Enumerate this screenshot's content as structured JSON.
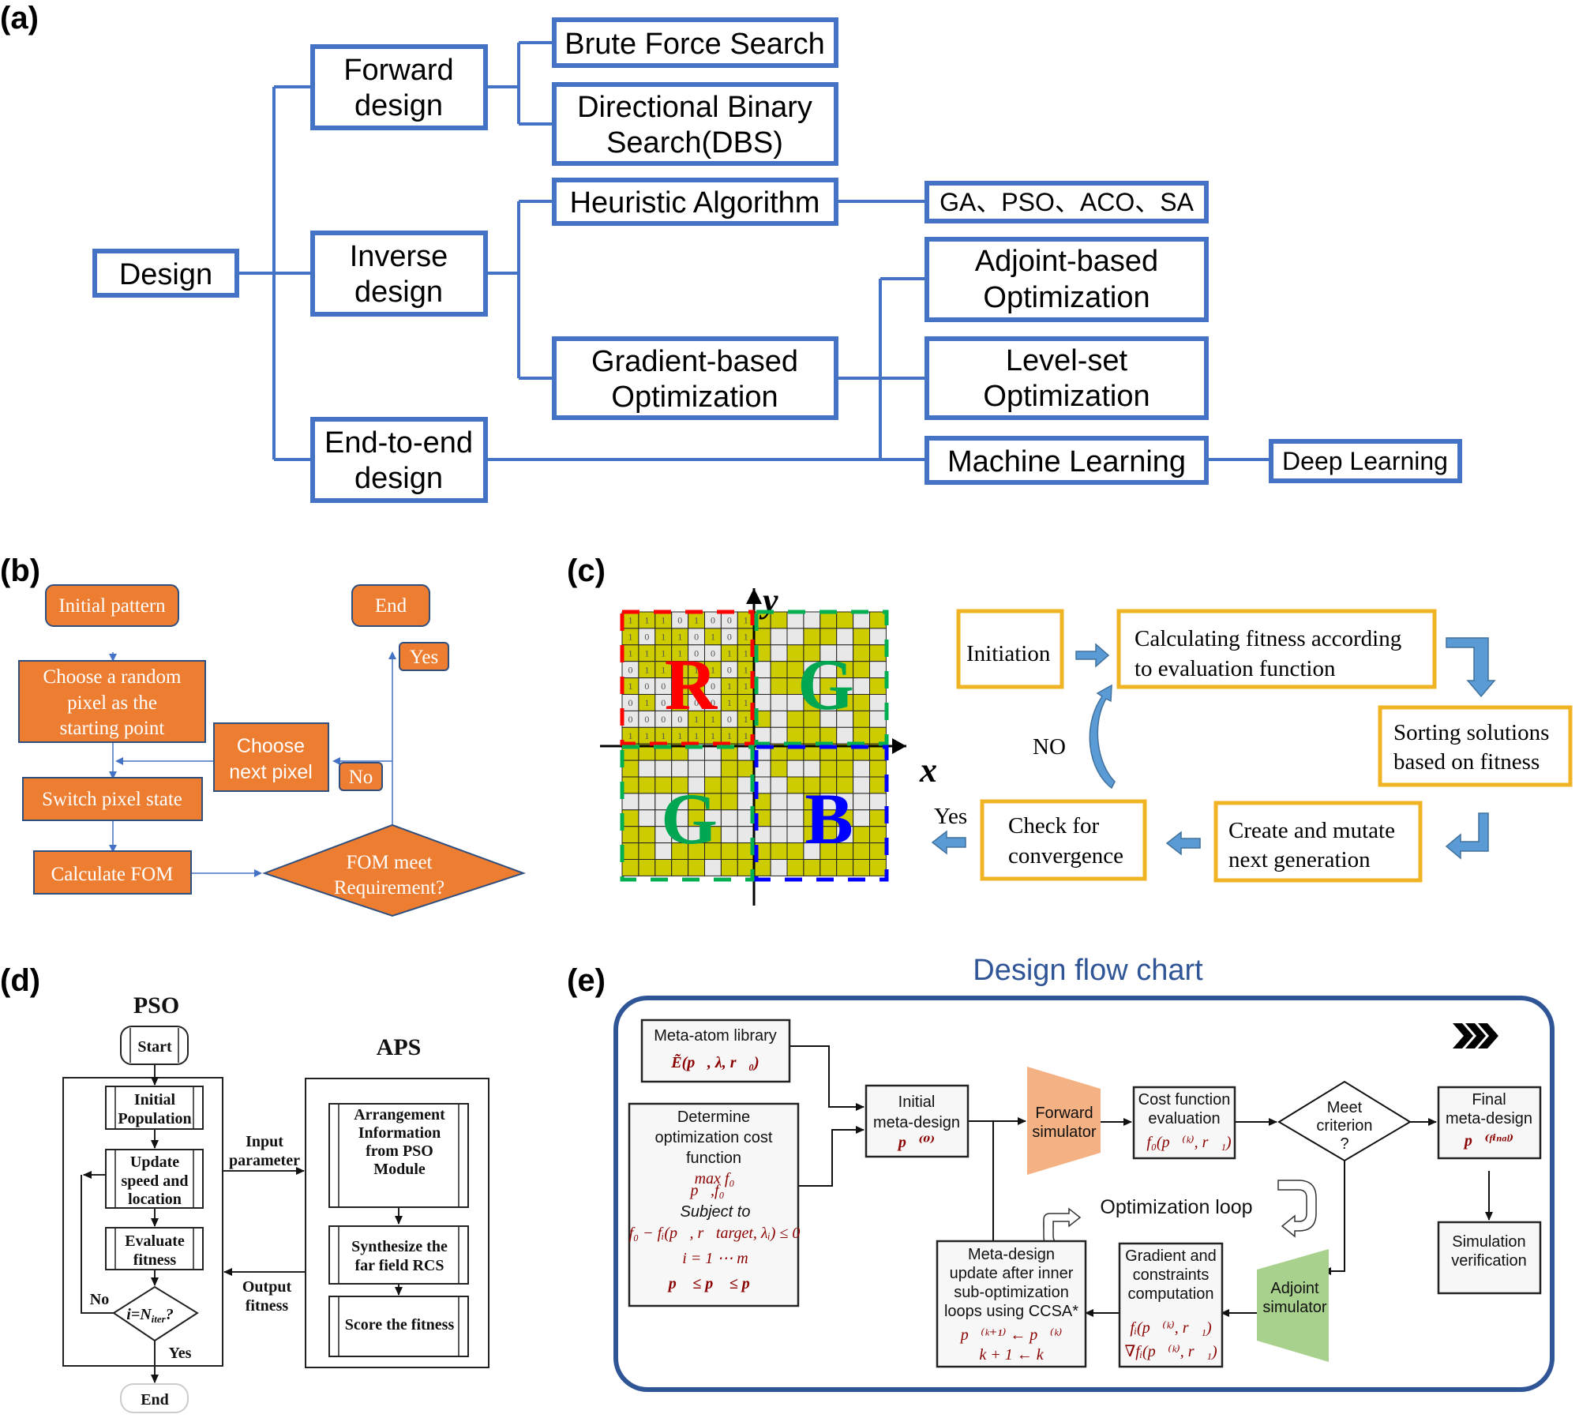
{
  "panels": {
    "a": {
      "label": "(a)",
      "nodes": {
        "design": [
          "Design"
        ],
        "forward": [
          "Forward",
          "design"
        ],
        "inverse": [
          "Inverse",
          "design"
        ],
        "endtoend": [
          "End-to-end",
          "design"
        ],
        "brute": [
          "Brute Force Search"
        ],
        "dbs": [
          "Directional Binary",
          "Search(DBS)"
        ],
        "heuristic": [
          "Heuristic Algorithm"
        ],
        "gradient": [
          "Gradient-based",
          "Optimization"
        ],
        "gapso": [
          "GA、PSO、ACO、SA"
        ],
        "adjoint": [
          "Adjoint-based",
          "Optimization"
        ],
        "levelset": [
          "Level-set",
          "Optimization"
        ],
        "ml": [
          "Machine Learning"
        ],
        "dl": [
          "Deep Learning"
        ]
      },
      "colors": {
        "stroke": "#4472c4"
      }
    },
    "b": {
      "label": "(b)",
      "initial": "Initial pattern",
      "random": [
        "Choose a random",
        "pixel as the",
        "starting point"
      ],
      "switch": "Switch pixel state",
      "calc": "Calculate FOM",
      "decision": [
        "FOM meet",
        "Requirement?"
      ],
      "next": [
        "Choose",
        "next pixel"
      ],
      "end": "End",
      "yes": "Yes",
      "no": "No",
      "colors": {
        "fill": "#ed7d31",
        "line": "#4472c4"
      }
    },
    "c": {
      "label": "(c)",
      "axis_x": "x",
      "axis_y": "y",
      "quadrants": {
        "tl": "R",
        "tr": "G",
        "bl": "G",
        "br": "B"
      },
      "bits": [
        [
          1,
          1,
          1,
          0,
          1,
          0,
          0,
          1
        ],
        [
          1,
          0,
          1,
          1,
          0,
          1,
          0,
          1
        ],
        [
          1,
          1,
          1,
          1,
          0,
          0,
          1,
          1
        ],
        [
          0,
          1,
          1,
          1,
          1,
          1,
          0,
          1
        ],
        [
          1,
          0,
          0,
          1,
          1,
          0,
          1,
          1
        ],
        [
          0,
          1,
          0,
          1,
          0,
          0,
          1,
          1
        ],
        [
          0,
          0,
          0,
          0,
          1,
          1,
          0,
          1
        ],
        [
          1,
          1,
          1,
          1,
          1,
          1,
          1,
          1
        ]
      ],
      "initiation": "Initiation",
      "calculating": [
        "Calculating fitness according",
        "to  evaluation function"
      ],
      "sorting": [
        "Sorting solutions",
        "based on fitness"
      ],
      "create": [
        "Create  and mutate",
        "next generation"
      ],
      "check": [
        "Check for",
        "convergence"
      ],
      "no": "NO",
      "yes": "Yes",
      "colors": {
        "box": "#f0b323",
        "arrow": "#5b9bd5",
        "pixel_on": "#cccc00",
        "pixel_off": "#e8e8e8",
        "r": "#ff0000",
        "g": "#00a651",
        "b": "#0000ff"
      }
    },
    "d": {
      "label": "(d)",
      "pso_title": "PSO",
      "aps_title": "APS",
      "start": "Start",
      "initial": [
        "Initial",
        "Population"
      ],
      "update": [
        "Update",
        "speed and",
        "location"
      ],
      "evaluate": [
        "Evaluate",
        "fitness"
      ],
      "decision": "i=N",
      "decision_sub": "iter",
      "decision_q": "?",
      "no": "No",
      "yes": "Yes",
      "end": "End",
      "input": [
        "Input",
        "parameter"
      ],
      "output": [
        "Output",
        "fitness"
      ],
      "arrangement": [
        "Arrangement",
        "Information",
        "from PSO",
        "Module"
      ],
      "synth": [
        "Synthesize the",
        "far field RCS"
      ],
      "score": "Score the fitness"
    },
    "e": {
      "label": "(e)",
      "title": "Design flow chart",
      "meta_atom": "Meta-atom library",
      "meta_atom_math": "Ẽ(p⃗, λ, r⃗₀)",
      "determine": [
        "Determine",
        "optimization cost",
        "function"
      ],
      "max": "max f₀",
      "max_sub": "p⃗,f₀",
      "subject": "Subject to",
      "constraint": "f₀ − fᵢ(p⃗, r⃗target, λᵢ) ≤ 0",
      "i_range": "i = 1 ⋯ m",
      "bounds": "p⃗ ≤ p⃗ ≤ p⃗",
      "initial": [
        "Initial",
        "meta-design"
      ],
      "initial_math": "p⃗⁽⁰⁾",
      "forward": [
        "Forward",
        "simulator"
      ],
      "cost": [
        "Cost function",
        "evaluation"
      ],
      "cost_math": "f₀(p⃗⁽ᵏ⁾, r⃗₁)",
      "meet": [
        "Meet",
        "criterion",
        "?"
      ],
      "final": [
        "Final",
        "meta-design"
      ],
      "final_math": "p⃗⁽ᶠⁱⁿᵃˡ⁾",
      "simulation": [
        "Simulation",
        "verification"
      ],
      "loop": "Optimization loop",
      "update": [
        "Meta-design",
        "update after inner",
        "sub-optimization",
        "loops using CCSA*"
      ],
      "update_math": [
        "p⃗⁽ᵏ⁺¹⁾ ← p⃗⁽ᵏ⁾",
        "k + 1 ← k"
      ],
      "gradient": [
        "Gradient and",
        "constraints",
        "computation"
      ],
      "gradient_math": [
        "fᵢ(p⃗⁽ᵏ⁾, r⃗₁)",
        "∇fᵢ(p⃗⁽ᵏ⁾, r⃗₁)"
      ],
      "adjoint": [
        "Adjoint",
        "simulator"
      ],
      "chevrons": "»»",
      "colors": {
        "frame": "#2f5597",
        "title": "#2f5597",
        "forward": "#f4b183",
        "adjoint": "#a9d18e",
        "math": "#8b0000"
      }
    }
  }
}
